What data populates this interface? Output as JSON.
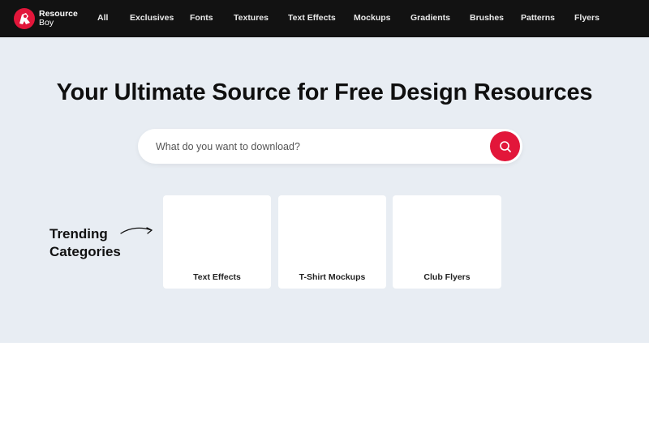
{
  "brand": {
    "line1": "Resource",
    "line2": "Boy",
    "accent": "#e2163a"
  },
  "nav": [
    "All",
    "Exclusives",
    "Fonts",
    "Textures",
    "Text Effects",
    "Mockups",
    "Gradients",
    "Brushes",
    "Patterns",
    "Flyers"
  ],
  "hero": {
    "headline": "Your Ultimate Source for Free Design Resources",
    "search_placeholder": "What do you want to download?",
    "trending_line1": "Trending",
    "trending_line2": "Categories"
  },
  "categories": [
    {
      "label": "Text Effects"
    },
    {
      "label": "T-Shirt Mockups"
    },
    {
      "label": "Club Flyers"
    }
  ],
  "colors": {
    "topbar": "#121212",
    "hero_bg": "#e8edf3",
    "search_button": "#e2163a"
  }
}
